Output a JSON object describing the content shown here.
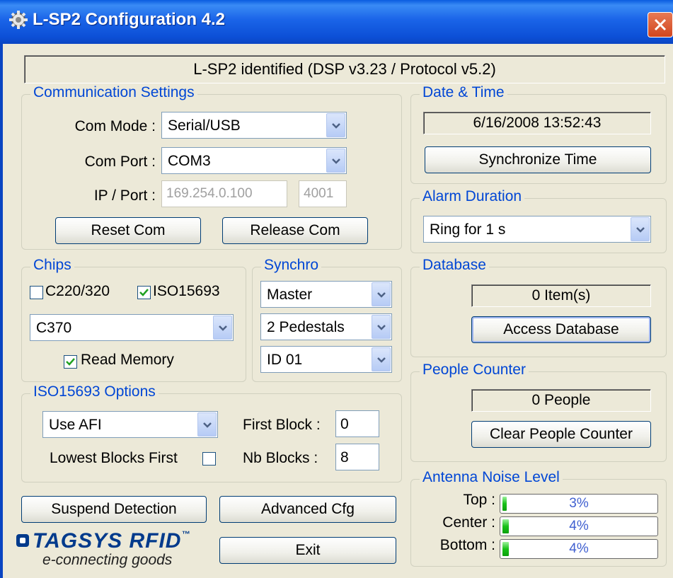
{
  "window": {
    "title": "L-SP2 Configuration 4.2"
  },
  "status": "L-SP2 identified (DSP v3.23 / Protocol v5.2)",
  "communication": {
    "label": "Communication Settings",
    "com_mode_label": "Com Mode :",
    "com_mode_value": "Serial/USB",
    "com_port_label": "Com Port :",
    "com_port_value": "COM3",
    "ip_port_label": "IP / Port :",
    "ip_value": "169.254.0.100",
    "port_value": "4001",
    "reset_label": "Reset Com",
    "release_label": "Release Com"
  },
  "chips": {
    "label": "Chips",
    "c220_label": "C220/320",
    "c220_checked": false,
    "iso_label": "ISO15693",
    "iso_checked": true,
    "chip_value": "C370",
    "read_memory_label": "Read Memory",
    "read_memory_checked": true
  },
  "synchro": {
    "label": "Synchro",
    "mode_value": "Master",
    "pedestals_value": "2 Pedestals",
    "id_value": "ID 01"
  },
  "iso_options": {
    "label": "ISO15693 Options",
    "afi_value": "Use AFI",
    "first_block_label": "First Block :",
    "first_block_value": "0",
    "lowest_label": "Lowest Blocks First",
    "lowest_checked": false,
    "nb_blocks_label": "Nb Blocks :",
    "nb_blocks_value": "8"
  },
  "buttons": {
    "suspend": "Suspend Detection",
    "advanced": "Advanced Cfg",
    "exit": "Exit"
  },
  "logo": {
    "main": "TAGSYS RFID",
    "tm": "™",
    "sub": "e-connecting goods"
  },
  "datetime": {
    "label": "Date & Time",
    "value": "6/16/2008 13:52:43",
    "sync_label": "Synchronize Time"
  },
  "alarm": {
    "label": "Alarm Duration",
    "value": "Ring for 1 s"
  },
  "database": {
    "label": "Database",
    "count": "0 Item(s)",
    "access_label": "Access Database"
  },
  "people": {
    "label": "People Counter",
    "count": "0 People",
    "clear_label": "Clear People Counter"
  },
  "antenna": {
    "label": "Antenna Noise Level",
    "top_label": "Top :",
    "top_value": "3%",
    "top_level": 0.03,
    "center_label": "Center :",
    "center_value": "4%",
    "center_level": 0.04,
    "bottom_label": "Bottom :",
    "bottom_value": "4%",
    "bottom_level": 0.04
  },
  "colors": {
    "group_label": "#0046d5",
    "titlebar": "#0a5de0",
    "progress_fill": "#18c118"
  }
}
